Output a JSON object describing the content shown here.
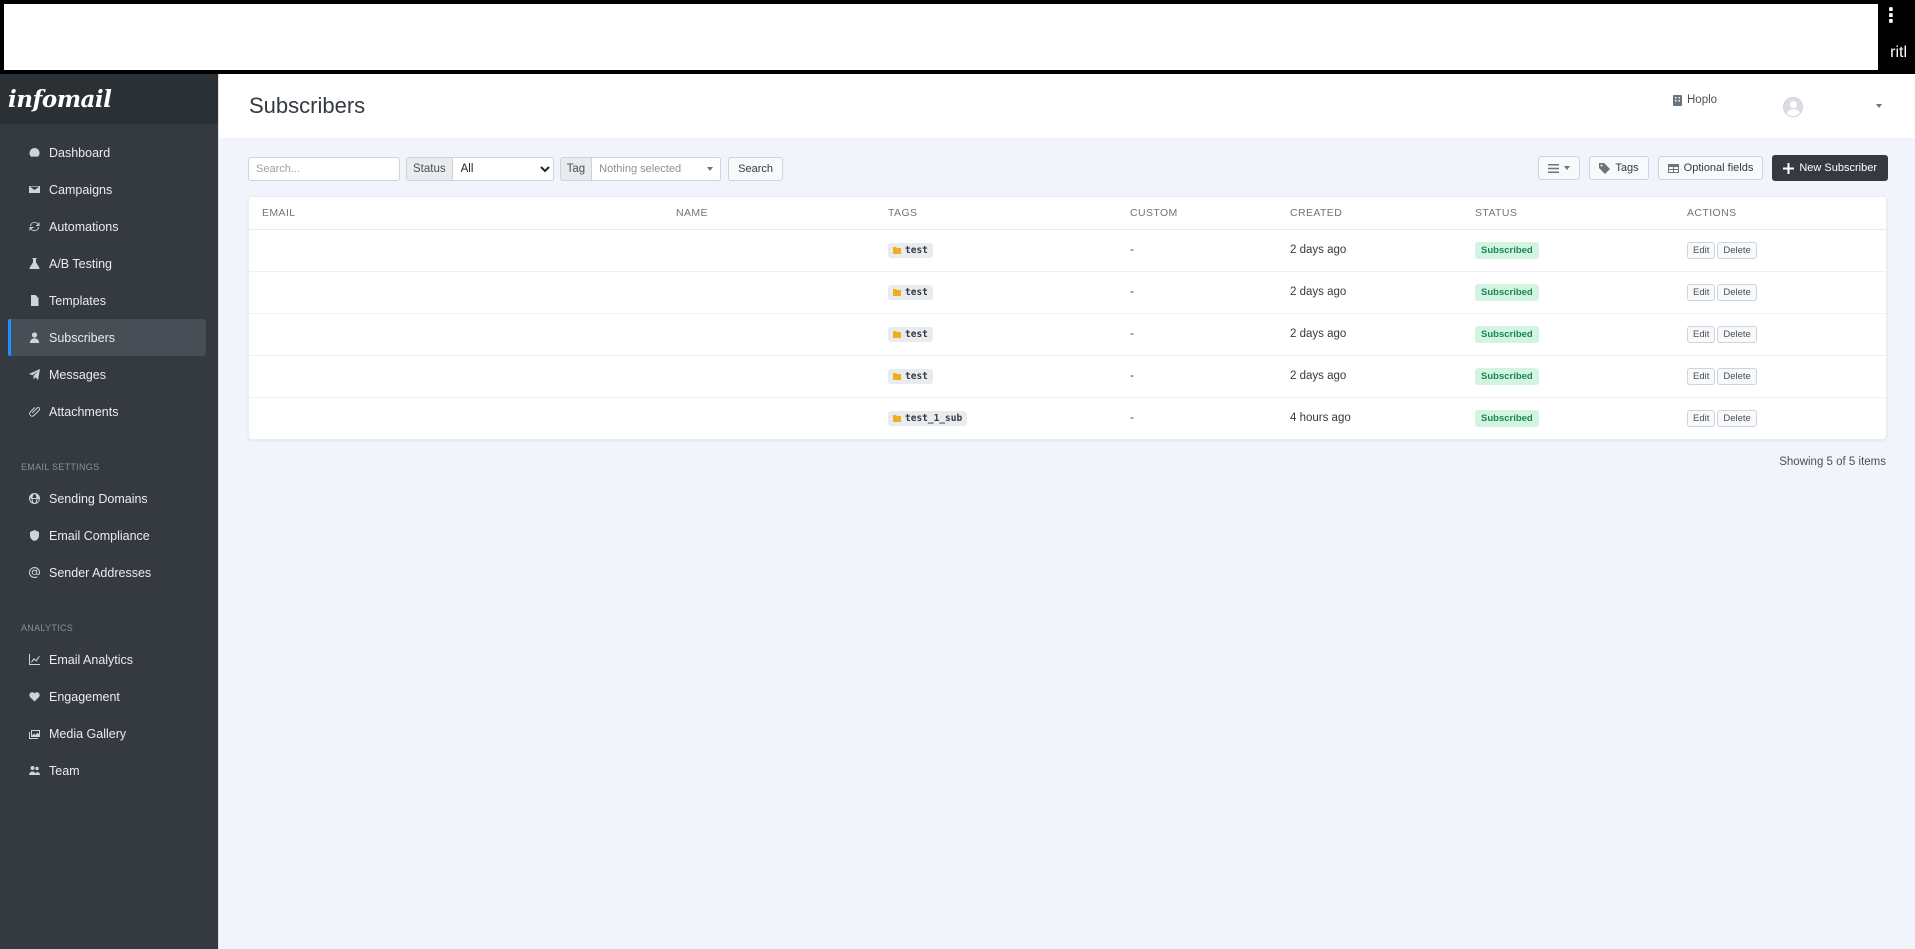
{
  "browser": {
    "menu_icon": "kebab-icon",
    "edge_text": "ritl"
  },
  "brand": {
    "logo_text": "infomail"
  },
  "sidebar": {
    "main_items": [
      {
        "label": "Dashboard",
        "icon": "tachometer-icon"
      },
      {
        "label": "Campaigns",
        "icon": "envelope-icon"
      },
      {
        "label": "Automations",
        "icon": "sync-icon"
      },
      {
        "label": "A/B Testing",
        "icon": "flask-icon"
      },
      {
        "label": "Templates",
        "icon": "file-icon"
      },
      {
        "label": "Subscribers",
        "icon": "user-icon",
        "active": true
      },
      {
        "label": "Messages",
        "icon": "paper-plane-icon"
      },
      {
        "label": "Attachments",
        "icon": "paperclip-icon"
      }
    ],
    "email_settings_heading": "EMAIL SETTINGS",
    "email_settings_items": [
      {
        "label": "Sending Domains",
        "icon": "globe-icon"
      },
      {
        "label": "Email Compliance",
        "icon": "shield-icon"
      },
      {
        "label": "Sender Addresses",
        "icon": "at-icon"
      }
    ],
    "analytics_heading": "ANALYTICS",
    "analytics_items": [
      {
        "label": "Email Analytics",
        "icon": "chart-line-icon"
      },
      {
        "label": "Engagement",
        "icon": "heart-icon"
      },
      {
        "label": "Media Gallery",
        "icon": "images-icon"
      },
      {
        "label": "Team",
        "icon": "users-icon"
      }
    ]
  },
  "header": {
    "title": "Subscribers",
    "org_name": "Hoplo"
  },
  "filters": {
    "search_placeholder": "Search...",
    "status_label": "Status",
    "status_value": "All",
    "tag_label": "Tag",
    "tag_placeholder": "Nothing selected",
    "search_button": "Search"
  },
  "actions": {
    "tags_button": "Tags",
    "optional_fields_button": "Optional fields",
    "new_subscriber_button": "New Subscriber"
  },
  "table": {
    "columns": [
      "EMAIL",
      "NAME",
      "TAGS",
      "CUSTOM",
      "CREATED",
      "STATUS",
      "ACTIONS"
    ],
    "rows": [
      {
        "email": "",
        "name": "",
        "tag": "test",
        "custom": "-",
        "created": "2 days ago",
        "status": "Subscribed"
      },
      {
        "email": "",
        "name": "",
        "tag": "test",
        "custom": "-",
        "created": "2 days ago",
        "status": "Subscribed"
      },
      {
        "email": "",
        "name": "",
        "tag": "test",
        "custom": "-",
        "created": "2 days ago",
        "status": "Subscribed"
      },
      {
        "email": "",
        "name": "",
        "tag": "test",
        "custom": "-",
        "created": "2 days ago",
        "status": "Subscribed"
      },
      {
        "email": "",
        "name": "",
        "tag": "test_1_sub",
        "custom": "-",
        "created": "4 hours ago",
        "status": "Subscribed"
      }
    ],
    "edit_label": "Edit",
    "delete_label": "Delete"
  },
  "pagination": {
    "summary": "Showing 5 of 5 items"
  },
  "colors": {
    "sidebar_bg": "#343a40",
    "main_bg": "#f1f5fb",
    "accent": "#1e90ff",
    "badge_bg": "#d4f4e2",
    "badge_text": "#198754"
  }
}
